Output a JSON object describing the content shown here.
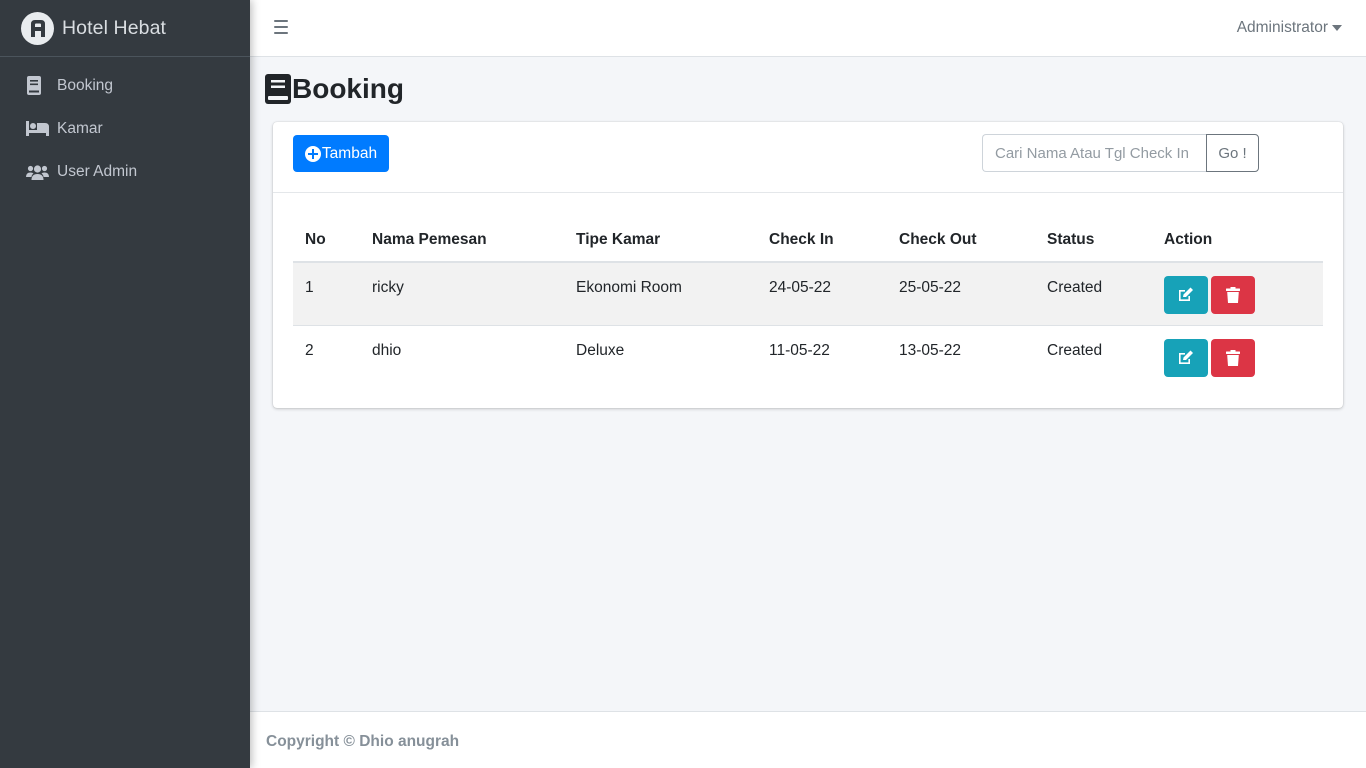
{
  "brand": {
    "name": "Hotel Hebat"
  },
  "sidebar": {
    "items": [
      {
        "label": "Booking",
        "icon": "book-icon"
      },
      {
        "label": "Kamar",
        "icon": "bed-icon"
      },
      {
        "label": "User Admin",
        "icon": "users-icon"
      }
    ]
  },
  "topbar": {
    "user": "Administrator"
  },
  "page": {
    "title": "Booking"
  },
  "toolbar": {
    "add_label": "Tambah",
    "search_placeholder": "Cari Nama Atau Tgl Check In",
    "go_label": "Go !"
  },
  "table": {
    "headers": [
      "No",
      "Nama Pemesan",
      "Tipe Kamar",
      "Check In",
      "Check Out",
      "Status",
      "Action"
    ],
    "rows": [
      {
        "no": "1",
        "nama": "ricky",
        "tipe": "Ekonomi Room",
        "check_in": "24-05-22",
        "check_out": "25-05-22",
        "status": "Created"
      },
      {
        "no": "2",
        "nama": "dhio",
        "tipe": "Deluxe",
        "check_in": "11-05-22",
        "check_out": "13-05-22",
        "status": "Created"
      }
    ]
  },
  "footer": {
    "text": "Copyright © Dhio anugrah"
  },
  "colors": {
    "sidebar_bg": "#343a40",
    "primary": "#007bff",
    "info": "#17a2b8",
    "danger": "#dc3545"
  }
}
